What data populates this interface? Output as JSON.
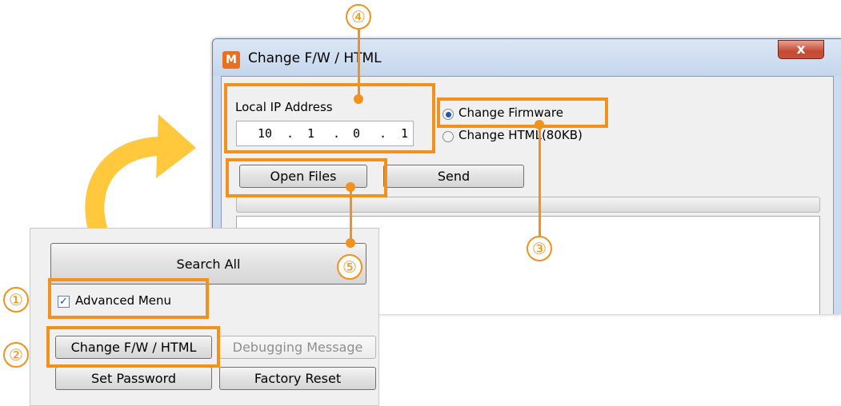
{
  "window": {
    "title": "Change F/W / HTML",
    "icon_letter": "M",
    "close_label": "x",
    "local_ip": {
      "label": "Local IP Address",
      "octets": [
        "10",
        "1",
        "0",
        "1"
      ],
      "separator": "."
    },
    "options": [
      {
        "label": "Change Firmware",
        "selected": true
      },
      {
        "label": "Change HTML(80KB)",
        "selected": false
      }
    ],
    "open_files_label": "Open Files",
    "send_label": "Send",
    "progress": 0
  },
  "panel": {
    "search_all_label": "Search All",
    "advanced_menu_label": "Advanced Menu",
    "advanced_menu_checked": true,
    "check_glyph": "✓",
    "buttons": {
      "change_fw": "Change F/W / HTML",
      "debugging": "Debugging Message",
      "set_password": "Set Password",
      "factory_reset": "Factory Reset"
    }
  },
  "callouts": [
    "①",
    "②",
    "③",
    "④",
    "⑤"
  ],
  "colors": {
    "highlight": "#f2921c",
    "arrow": "#ffc83d"
  }
}
